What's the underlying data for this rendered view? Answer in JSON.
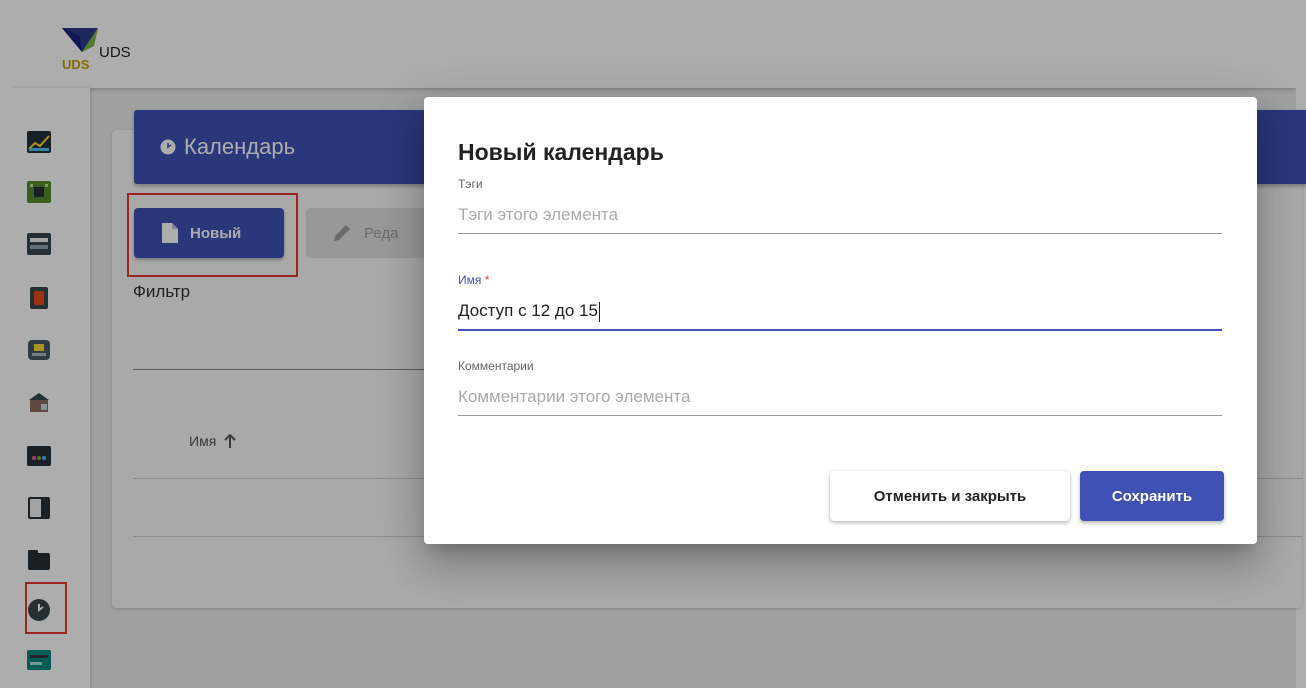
{
  "app": {
    "name": "UDS"
  },
  "page": {
    "title": "Календарь",
    "new_button": "Новый",
    "edit_button": "Реда",
    "filter_label": "Фильтр",
    "column_name": "Имя"
  },
  "sidebar": {
    "items": [
      {
        "icon": "dashboard-icon"
      },
      {
        "icon": "services-icon"
      },
      {
        "icon": "authenticators-icon"
      },
      {
        "icon": "os-managers-icon"
      },
      {
        "icon": "connectivity-icon"
      },
      {
        "icon": "pools-icon"
      },
      {
        "icon": "transports-icon"
      },
      {
        "icon": "networks-icon"
      },
      {
        "icon": "gallery-icon"
      },
      {
        "icon": "calendar-icon",
        "selected": true
      },
      {
        "icon": "accounts-icon"
      }
    ]
  },
  "dialog": {
    "title": "Новый календарь",
    "tags": {
      "label": "Тэги",
      "placeholder": "Тэги этого элемента"
    },
    "name": {
      "label": "Имя",
      "required_mark": "*",
      "value": "Доступ с 12 до 15"
    },
    "comments": {
      "label": "Комментарии",
      "placeholder": "Комментарии этого элемента"
    },
    "cancel_button": "Отменить и закрыть",
    "save_button": "Сохранить"
  },
  "colors": {
    "primary": "#3f51b5",
    "highlight": "#e53935"
  }
}
